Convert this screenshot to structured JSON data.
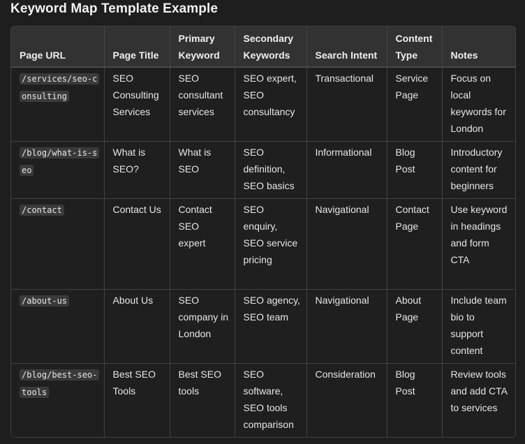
{
  "title": "Keyword Map Template Example",
  "table": {
    "headers": {
      "page_url": "Page URL",
      "page_title": "Page Title",
      "primary_keyword": "Primary Keyword",
      "secondary_keywords": "Secondary Keywords",
      "search_intent": "Search Intent",
      "content_type": "Content Type",
      "notes": "Notes"
    },
    "rows": [
      {
        "page_url": "/services/seo-consulting",
        "page_title": "SEO Consulting Services",
        "primary_keyword": "SEO consultant services",
        "secondary_keywords": "SEO expert, SEO consultancy",
        "search_intent": "Transactional",
        "content_type": "Service Page",
        "notes": "Focus on local keywords for London"
      },
      {
        "page_url": "/blog/what-is-seo",
        "page_title": "What is SEO?",
        "primary_keyword": "What is SEO",
        "secondary_keywords": "SEO definition, SEO basics",
        "search_intent": "Informational",
        "content_type": "Blog Post",
        "notes": "Introductory content for beginners"
      },
      {
        "page_url": "/contact",
        "page_title": "Contact Us",
        "primary_keyword": "Contact SEO expert",
        "secondary_keywords": "SEO enquiry, SEO service pricing",
        "search_intent": "Navigational",
        "content_type": "Contact Page",
        "notes": "Use keyword in headings and form CTA"
      },
      {
        "page_url": "/about-us",
        "page_title": "About Us",
        "primary_keyword": "SEO company in London",
        "secondary_keywords": "SEO agency, SEO team",
        "search_intent": "Navigational",
        "content_type": "About Page",
        "notes": "Include team bio to support content"
      },
      {
        "page_url": "/blog/best-seo-tools",
        "page_title": "Best SEO Tools",
        "primary_keyword": "Best SEO tools",
        "secondary_keywords": "SEO software, SEO tools comparison",
        "search_intent": "Consideration",
        "content_type": "Blog Post",
        "notes": "Review tools and add CTA to services"
      }
    ]
  }
}
